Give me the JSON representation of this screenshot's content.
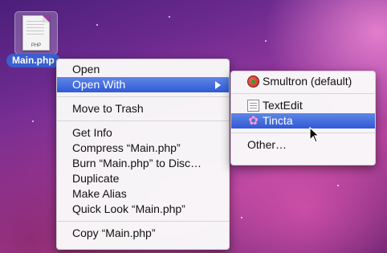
{
  "desktop": {
    "file": {
      "name": "Main.php",
      "icon": "php-file-icon",
      "badge": "PHP"
    }
  },
  "context_menu": {
    "items": [
      {
        "label": "Open"
      },
      {
        "label": "Open With"
      },
      {
        "label": "Move to Trash"
      },
      {
        "label": "Get Info"
      },
      {
        "label": "Compress “Main.php”"
      },
      {
        "label": "Burn “Main.php” to Disc…"
      },
      {
        "label": "Duplicate"
      },
      {
        "label": "Make Alias"
      },
      {
        "label": "Quick Look “Main.php”"
      },
      {
        "label": "Copy “Main.php”"
      }
    ]
  },
  "open_with_submenu": {
    "items": [
      {
        "label": "Smultron (default)",
        "icon": "smultron-icon"
      },
      {
        "label": "TextEdit",
        "icon": "textedit-icon"
      },
      {
        "label": "Tincta",
        "icon": "tincta-icon"
      },
      {
        "label": "Other…"
      }
    ]
  },
  "colors": {
    "highlight": "#3a65db",
    "file_label": "#3a5fd0"
  }
}
